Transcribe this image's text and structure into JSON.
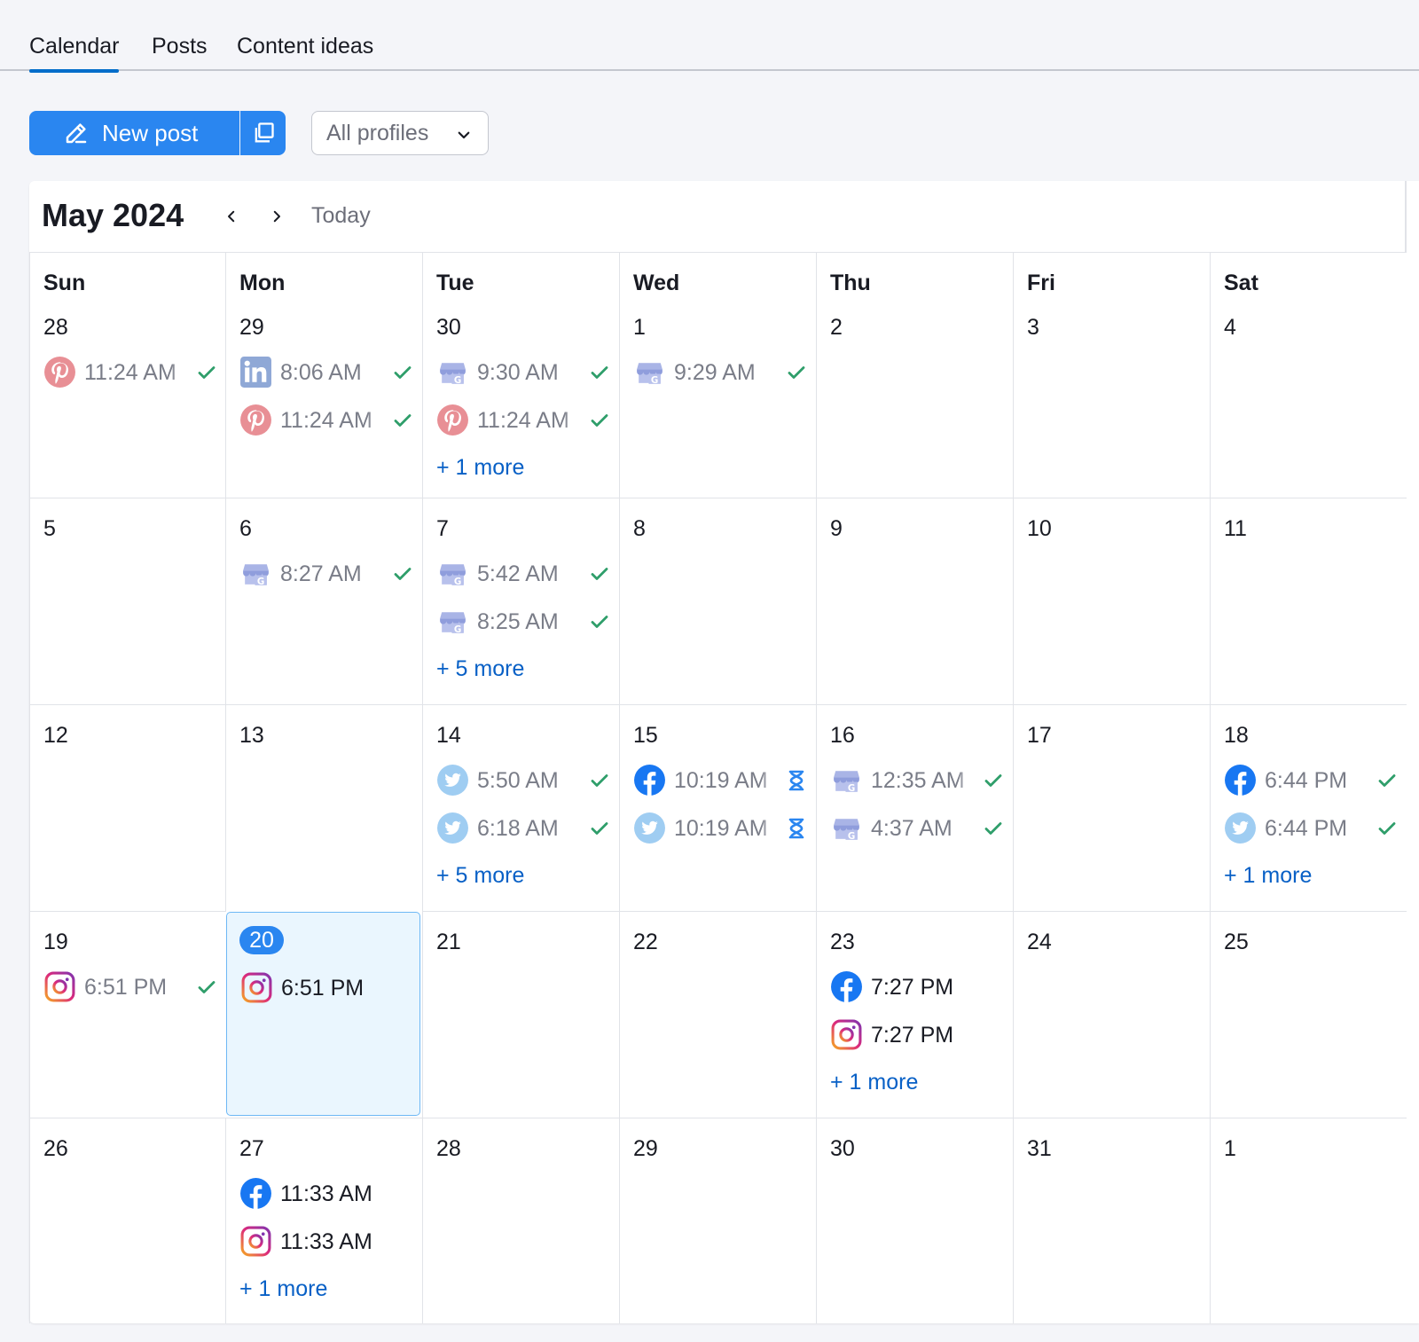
{
  "tabs": [
    {
      "label": "Calendar",
      "active": true
    },
    {
      "label": "Posts",
      "active": false
    },
    {
      "label": "Content ideas",
      "active": false
    }
  ],
  "toolbar": {
    "new_post_label": "New post",
    "profile_select": "All profiles"
  },
  "calendar": {
    "month_title": "May 2024",
    "today_label": "Today",
    "weekdays": [
      "Sun",
      "Mon",
      "Tue",
      "Wed",
      "Thu",
      "Fri",
      "Sat"
    ],
    "weeks": [
      [
        {
          "day": "28",
          "posts": [
            {
              "network": "pinterest",
              "time": "11:24 AM",
              "status": "published"
            }
          ]
        },
        {
          "day": "29",
          "posts": [
            {
              "network": "linkedin",
              "time": "8:06 AM",
              "status": "published"
            },
            {
              "network": "pinterest",
              "time": "11:24 AM",
              "status": "published"
            }
          ]
        },
        {
          "day": "30",
          "posts": [
            {
              "network": "google-business",
              "time": "9:30 AM",
              "status": "published"
            },
            {
              "network": "pinterest",
              "time": "11:24 AM",
              "status": "published"
            }
          ],
          "more": "+ 1 more"
        },
        {
          "day": "1",
          "posts": [
            {
              "network": "google-business",
              "time": "9:29 AM",
              "status": "published"
            }
          ]
        },
        {
          "day": "2",
          "posts": []
        },
        {
          "day": "3",
          "posts": []
        },
        {
          "day": "4",
          "posts": []
        }
      ],
      [
        {
          "day": "5",
          "posts": []
        },
        {
          "day": "6",
          "posts": [
            {
              "network": "google-business",
              "time": "8:27 AM",
              "status": "published"
            }
          ]
        },
        {
          "day": "7",
          "posts": [
            {
              "network": "google-business",
              "time": "5:42 AM",
              "status": "published"
            },
            {
              "network": "google-business",
              "time": "8:25 AM",
              "status": "published"
            }
          ],
          "more": "+ 5 more"
        },
        {
          "day": "8",
          "posts": []
        },
        {
          "day": "9",
          "posts": []
        },
        {
          "day": "10",
          "posts": []
        },
        {
          "day": "11",
          "posts": []
        }
      ],
      [
        {
          "day": "12",
          "posts": []
        },
        {
          "day": "13",
          "posts": []
        },
        {
          "day": "14",
          "posts": [
            {
              "network": "twitter",
              "time": "5:50 AM",
              "status": "published"
            },
            {
              "network": "twitter",
              "time": "6:18 AM",
              "status": "published"
            }
          ],
          "more": "+ 5 more"
        },
        {
          "day": "15",
          "posts": [
            {
              "network": "facebook",
              "time": "10:19 AM",
              "status": "pending"
            },
            {
              "network": "twitter",
              "time": "10:19 AM",
              "status": "pending"
            }
          ]
        },
        {
          "day": "16",
          "posts": [
            {
              "network": "google-business",
              "time": "12:35 AM",
              "status": "published"
            },
            {
              "network": "google-business",
              "time": "4:37 AM",
              "status": "published"
            }
          ]
        },
        {
          "day": "17",
          "posts": []
        },
        {
          "day": "18",
          "posts": [
            {
              "network": "facebook",
              "time": "6:44 PM",
              "status": "published"
            },
            {
              "network": "twitter",
              "time": "6:44 PM",
              "status": "published"
            }
          ],
          "more": "+ 1 more"
        }
      ],
      [
        {
          "day": "19",
          "posts": [
            {
              "network": "instagram",
              "time": "6:51 PM",
              "status": "published"
            }
          ]
        },
        {
          "day": "20",
          "is_today": true,
          "posts": [
            {
              "network": "instagram",
              "time": "6:51 PM",
              "status": "scheduled"
            }
          ]
        },
        {
          "day": "21",
          "posts": []
        },
        {
          "day": "22",
          "posts": []
        },
        {
          "day": "23",
          "posts": [
            {
              "network": "facebook",
              "time": "7:27 PM",
              "status": "scheduled"
            },
            {
              "network": "instagram",
              "time": "7:27 PM",
              "status": "scheduled"
            }
          ],
          "more": "+ 1 more"
        },
        {
          "day": "24",
          "posts": []
        },
        {
          "day": "25",
          "posts": []
        }
      ],
      [
        {
          "day": "26",
          "posts": []
        },
        {
          "day": "27",
          "posts": [
            {
              "network": "facebook",
              "time": "11:33 AM",
              "status": "scheduled"
            },
            {
              "network": "instagram",
              "time": "11:33 AM",
              "status": "scheduled"
            }
          ],
          "more": "+ 1 more"
        },
        {
          "day": "28",
          "posts": []
        },
        {
          "day": "29",
          "posts": []
        },
        {
          "day": "30",
          "posts": []
        },
        {
          "day": "31",
          "posts": []
        },
        {
          "day": "1",
          "posts": []
        }
      ]
    ]
  },
  "colors": {
    "accent": "#2a86f0",
    "link": "#0860c6",
    "check": "#2f9e6a",
    "hourglass": "#2a86f0"
  }
}
